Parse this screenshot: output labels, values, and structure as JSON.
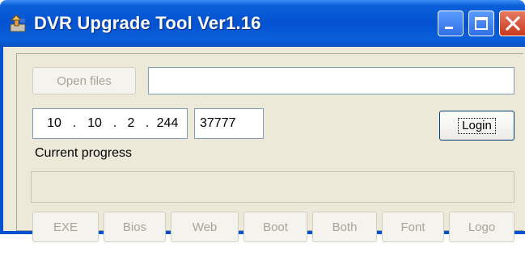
{
  "window": {
    "title": "DVR Upgrade Tool Ver1.16",
    "icon": "dvr-app-icon",
    "colors": {
      "titlebar": "#0452d1",
      "close_button": "#c9391e",
      "client_bg": "#ece9d8"
    }
  },
  "open_files": {
    "label": "Open files",
    "path_value": ""
  },
  "connection": {
    "ip": [
      "10",
      "10",
      "2",
      "244"
    ],
    "port": "37777",
    "login_label": "Login"
  },
  "progress": {
    "label": "Current progress",
    "value": 0
  },
  "upgrade_buttons": [
    "EXE",
    "Bios",
    "Web",
    "Boot",
    "Both",
    "Font",
    "Logo"
  ]
}
